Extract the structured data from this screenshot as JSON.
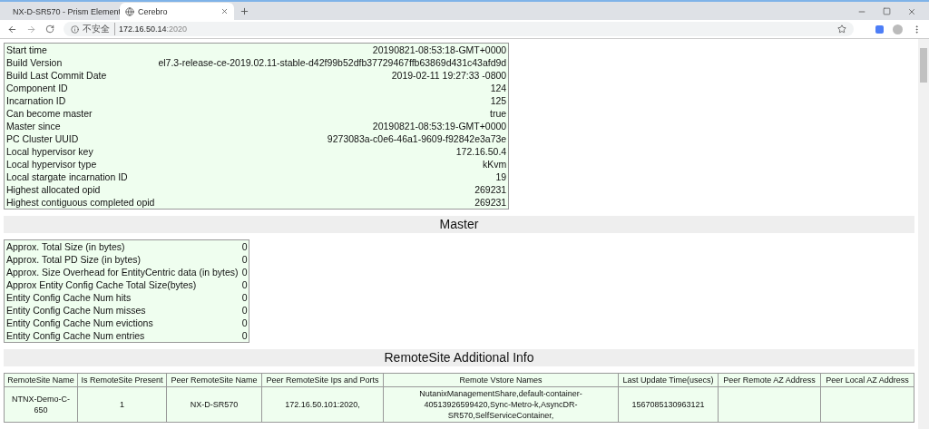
{
  "browser": {
    "tabs": [
      {
        "title": "NX-D-SR570 - Prism Element",
        "selected": false
      },
      {
        "title": "Cerebro",
        "selected": true
      }
    ],
    "address": {
      "security_label": "不安全",
      "host": "172.16.50.14",
      "port": ":2020"
    }
  },
  "info_table": [
    {
      "label": "Start time",
      "value": "20190821-08:53:18-GMT+0000"
    },
    {
      "label": "Build Version",
      "value": "el7.3-release-ce-2019.02.11-stable-d42f99b52dfb37729467ffb63869d431c43afd9d"
    },
    {
      "label": "Build Last Commit Date",
      "value": "2019-02-11 19:27:33 -0800"
    },
    {
      "label": "Component ID",
      "value": "124"
    },
    {
      "label": "Incarnation ID",
      "value": "125"
    },
    {
      "label": "Can become master",
      "value": "true"
    },
    {
      "label": "Master since",
      "value": "20190821-08:53:19-GMT+0000"
    },
    {
      "label": "PC Cluster UUID",
      "value": "9273083a-c0e6-46a1-9609-f92842e3a73e"
    },
    {
      "label": "Local hypervisor key",
      "value": "172.16.50.4"
    },
    {
      "label": "Local hypervisor type",
      "value": "kKvm"
    },
    {
      "label": "Local stargate incarnation ID",
      "value": "19"
    },
    {
      "label": "Highest allocated opid",
      "value": "269231"
    },
    {
      "label": "Highest contiguous completed opid",
      "value": "269231"
    }
  ],
  "master": {
    "title": "Master",
    "rows": [
      {
        "label": "Approx. Total Size (in bytes)",
        "value": "0"
      },
      {
        "label": "Approx. Total PD Size (in bytes)",
        "value": "0"
      },
      {
        "label": "Approx. Size Overhead for EntityCentric data (in bytes)",
        "value": "0"
      },
      {
        "label": "Approx Entity Config Cache Total Size(bytes)",
        "value": "0"
      },
      {
        "label": "Entity Config Cache Num hits",
        "value": "0"
      },
      {
        "label": "Entity Config Cache Num misses",
        "value": "0"
      },
      {
        "label": "Entity Config Cache Num evictions",
        "value": "0"
      },
      {
        "label": "Entity Config Cache Num entries",
        "value": "0"
      }
    ]
  },
  "remote_site": {
    "title": "RemoteSite Additional Info",
    "columns": [
      "RemoteSite Name",
      "Is RemoteSite Present",
      "Peer RemoteSite Name",
      "Peer RemoteSite Ips and Ports",
      "Remote Vstore Names",
      "Last Update Time(usecs)",
      "Peer Remote AZ Address",
      "Peer Local AZ Address"
    ],
    "rows": [
      [
        "NTNX-Demo-C-650",
        "1",
        "NX-D-SR570",
        "172.16.50.101:2020,",
        "NutanixManagementShare,default-container-40513926599420,Sync-Metro-k,AsyncDR-SR570,SelfServiceContainer,",
        "1567085130963121",
        "",
        ""
      ]
    ]
  }
}
